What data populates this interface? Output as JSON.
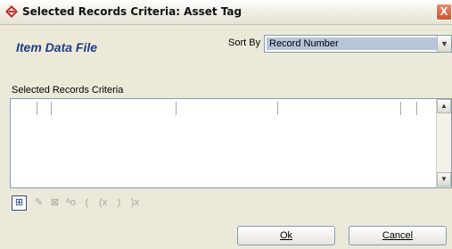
{
  "window": {
    "title": "Selected Records Criteria:  Asset Tag",
    "close_label": "X"
  },
  "form": {
    "heading": "Item Data File",
    "sort_by_label": "Sort By",
    "sort_by_value": "Record Number",
    "criteria_label": "Selected Records Criteria"
  },
  "toolbar": {
    "buttons": [
      {
        "icon": "add-criteria-icon",
        "glyph": "⊞",
        "enabled": true
      },
      {
        "icon": "edit-criteria-icon",
        "glyph": "✎",
        "enabled": false
      },
      {
        "icon": "delete-criteria-icon",
        "glyph": "⊠",
        "enabled": false
      },
      {
        "icon": "toggle-case-icon",
        "glyph": "ᴬo",
        "enabled": false
      },
      {
        "icon": "open-paren-icon",
        "glyph": "(",
        "enabled": false
      },
      {
        "icon": "remove-open-paren-icon",
        "glyph": "(x",
        "enabled": false
      },
      {
        "icon": "close-paren-icon",
        "glyph": ")",
        "enabled": false
      },
      {
        "icon": "remove-close-paren-icon",
        "glyph": ")x",
        "enabled": false
      }
    ]
  },
  "buttons": {
    "ok": "Ok",
    "cancel": "Cancel"
  }
}
